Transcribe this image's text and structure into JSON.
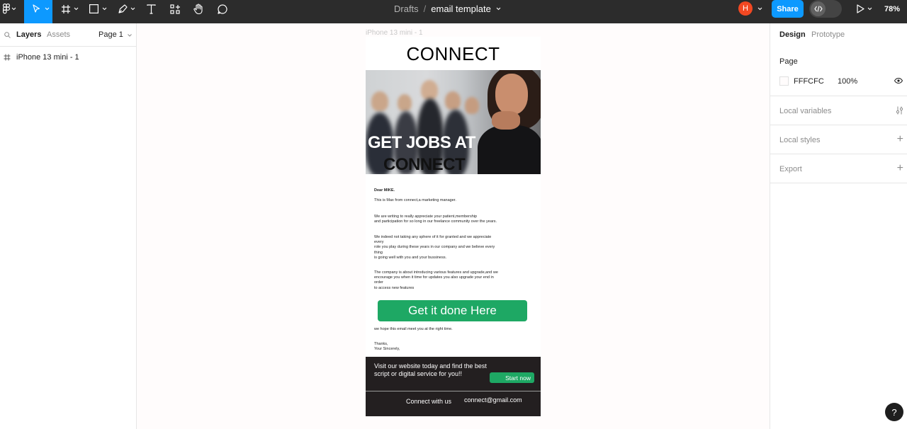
{
  "toolbar": {
    "breadcrumb_drafts": "Drafts",
    "breadcrumb_separator": "/",
    "file_name": "email template",
    "avatar_initial": "H",
    "share_label": "Share",
    "zoom": "78%",
    "colors": {
      "bar": "#2c2c2c",
      "accent": "#0d99ff",
      "avatar": "#f24822"
    }
  },
  "left_panel": {
    "layers_tab": "Layers",
    "assets_tab": "Assets",
    "page_select": "Page 1",
    "layers": [
      {
        "name": "iPhone 13 mini - 1",
        "icon": "frame-icon"
      }
    ]
  },
  "right_panel": {
    "design_tab": "Design",
    "prototype_tab": "Prototype",
    "page_section": "Page",
    "page_color": "FFFCFC",
    "page_opacity": "100%",
    "local_variables": "Local variables",
    "local_styles": "Local styles",
    "export": "Export"
  },
  "canvas": {
    "frame_label": "iPhone 13 mini - 1",
    "background": "#fffcfc",
    "email": {
      "title": "CONNECT",
      "hero_line1": "GET JOBS AT",
      "hero_line2": "CONNECT",
      "greeting": "Dear MIKE.",
      "intro": "This is Max from connect,a marketing manager.",
      "para1": "We are writing to really appreciate your patient,membership\nand participation for so long in our freelance community over the years.",
      "para2": "We indeed not taking any sphere of it for granted and we appreciate\nevery\nrole you play during these years in our company and we believe every\nthing\nis going well with you and your bussiness.",
      "para3": "The company is about introducing various features and upgrade,and we\nencourage you when it time for updates you also upgrade your end in\norder\nto access new features",
      "cta_label": "Get it done Here",
      "closing": "we hope this email meet you at the right time.",
      "signoff": "Thanks,\nYour Sincerely,",
      "footer_text": "Visit our website today and find the best\nscript or digital service for you!!",
      "start_now": "Start now",
      "connect_with": "Connect with us",
      "footer_email": "connect@gmail.com",
      "colors": {
        "cta": "#1ea864",
        "footer": "#231f20"
      }
    }
  },
  "help_label": "?"
}
